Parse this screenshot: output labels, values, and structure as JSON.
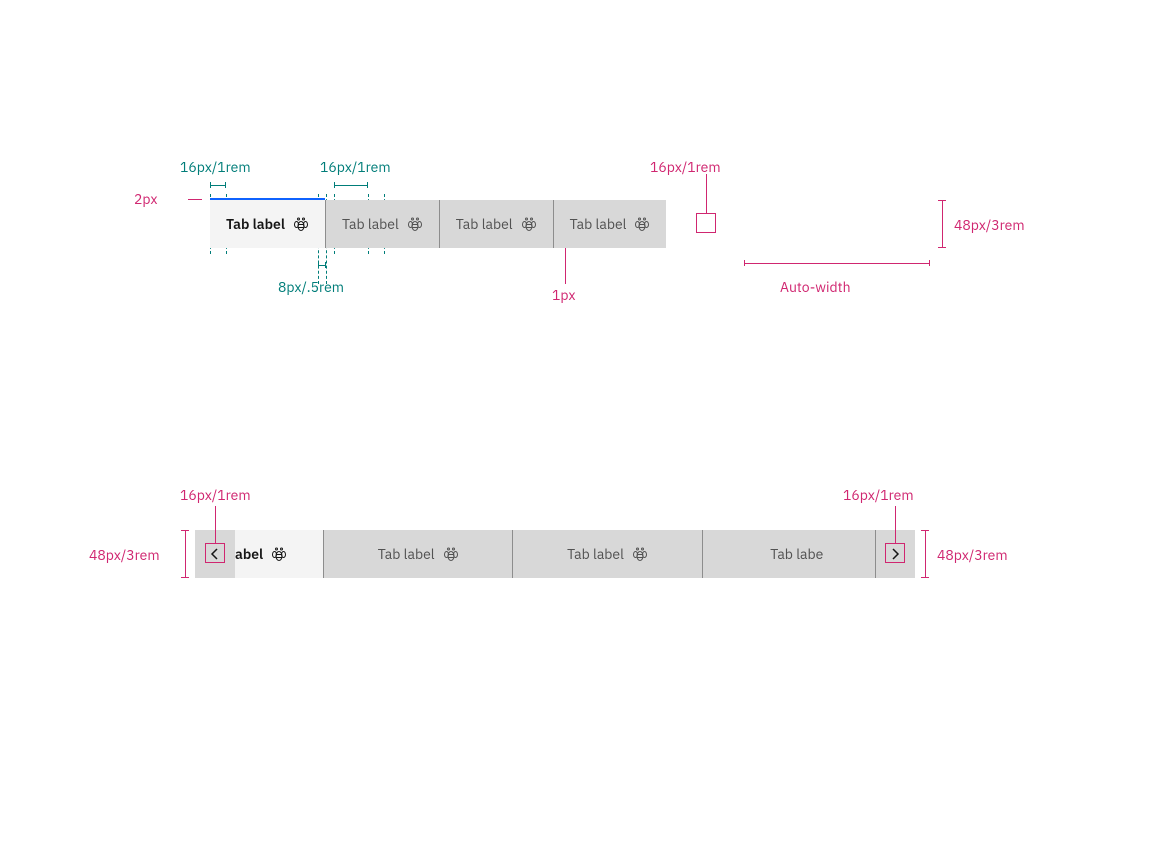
{
  "colors": {
    "teal": "#007d79",
    "pink": "#d02670",
    "blue": "#0f62fe"
  },
  "spec_top": {
    "padding_left": "16px/1rem",
    "padding_right": "16px/1rem",
    "icon_size": "16px/1rem",
    "indicator_thickness": "2px",
    "gap_label_icon": "8px/.5rem",
    "divider_thickness": "1px",
    "tab_width_mode": "Auto-width",
    "height": "48px/3rem"
  },
  "spec_bottom": {
    "scroll_icon_left": "16px/1rem",
    "scroll_icon_right": "16px/1rem",
    "height_left": "48px/3rem",
    "height_right": "48px/3rem"
  },
  "tabs_top": [
    {
      "label": "Tab label",
      "selected": true
    },
    {
      "label": "Tab label",
      "selected": false
    },
    {
      "label": "Tab label",
      "selected": false
    },
    {
      "label": "Tab label",
      "selected": false
    }
  ],
  "tabs_bottom": {
    "first_visible_fragment": "abel",
    "items": [
      {
        "label": "Tab label",
        "selected": true
      },
      {
        "label": "Tab label",
        "selected": false
      },
      {
        "label": "Tab label",
        "selected": false
      },
      {
        "label": "Tab labe",
        "selected": false
      }
    ]
  },
  "icon_name": "bee-icon"
}
